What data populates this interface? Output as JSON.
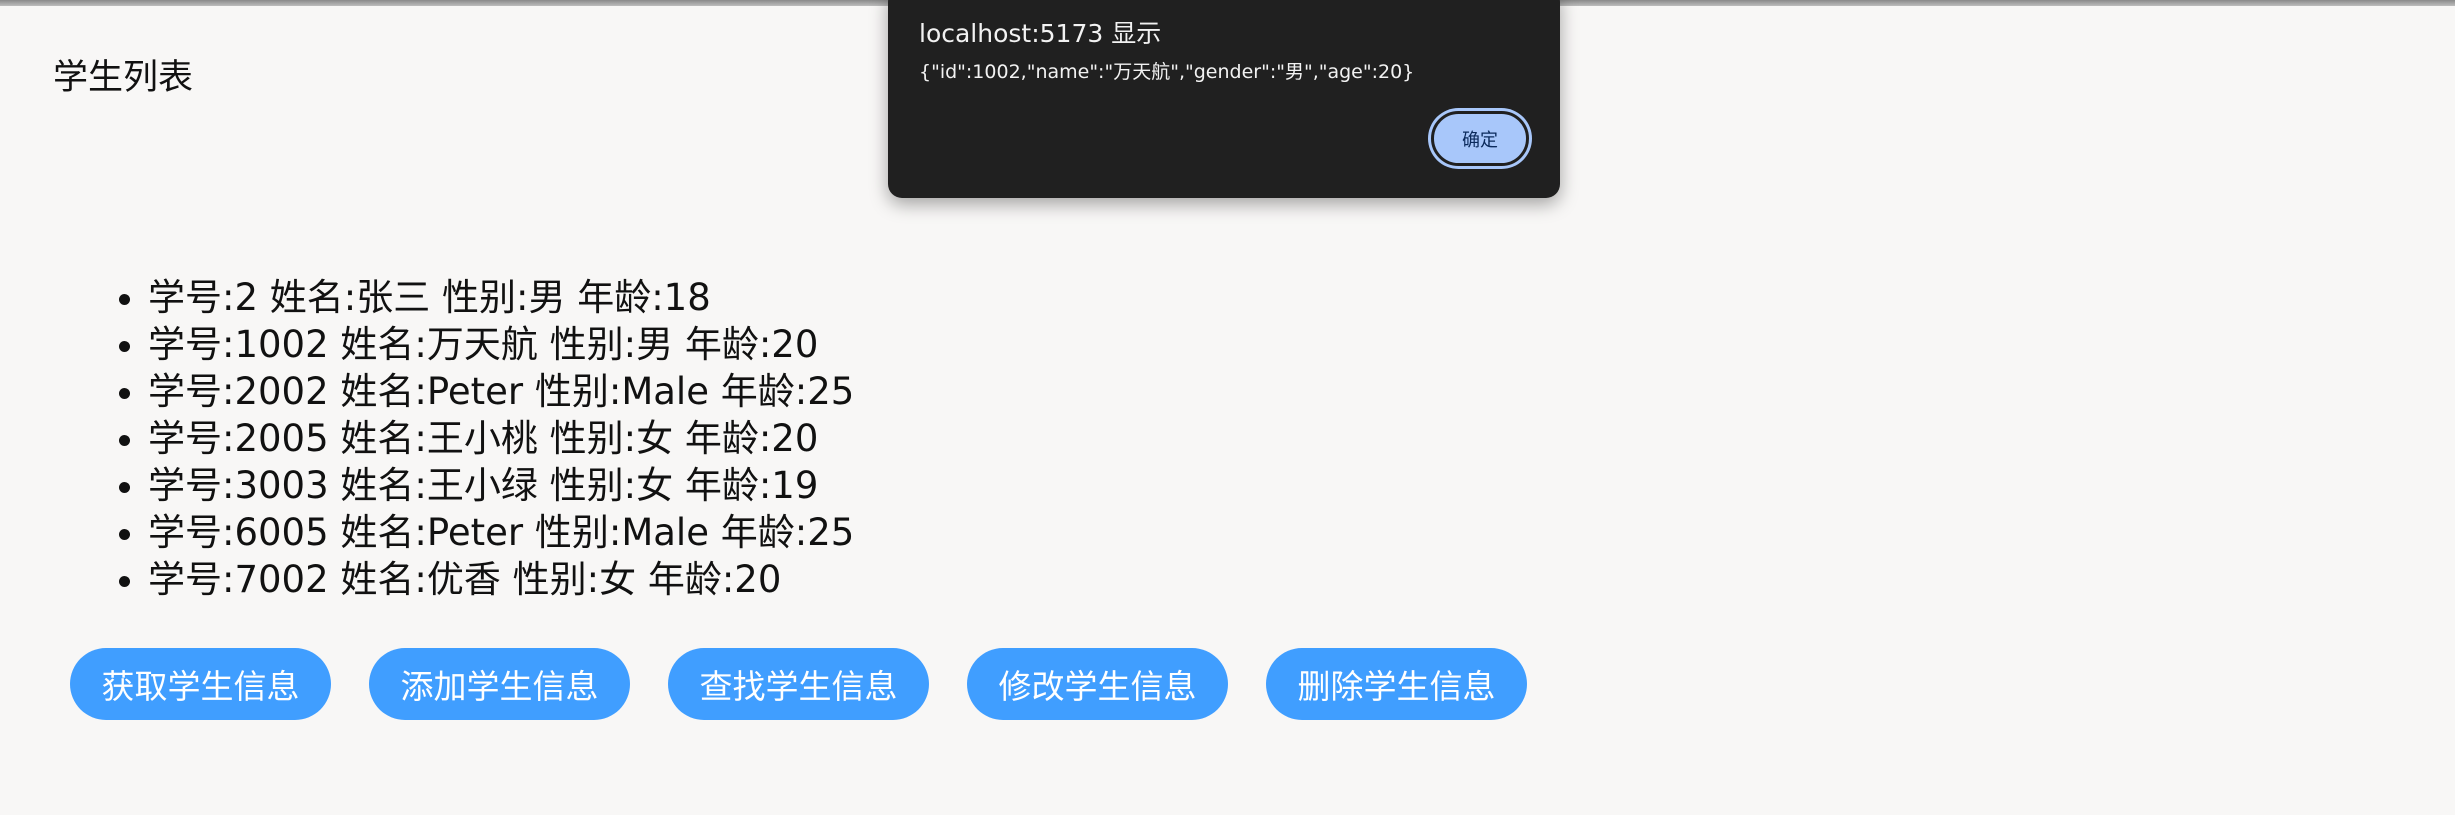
{
  "page": {
    "title": "学生列表"
  },
  "students": [
    {
      "text": "学号:2 姓名:张三 性别:男 年龄:18"
    },
    {
      "text": "学号:1002 姓名:万天航 性别:男 年龄:20"
    },
    {
      "text": "学号:2002 姓名:Peter 性别:Male 年龄:25"
    },
    {
      "text": "学号:2005 姓名:王小桃 性别:女 年龄:20"
    },
    {
      "text": "学号:3003 姓名:王小绿 性别:女 年龄:19"
    },
    {
      "text": "学号:6005 姓名:Peter 性别:Male 年龄:25"
    },
    {
      "text": "学号:7002 姓名:优香 性别:女 年龄:20"
    }
  ],
  "actions": {
    "get_label": "获取学生信息",
    "add_label": "添加学生信息",
    "find_label": "查找学生信息",
    "edit_label": "修改学生信息",
    "delete_label": "删除学生信息"
  },
  "dialog": {
    "title": "localhost:5173 显示",
    "message": "{\"id\":1002,\"name\":\"万天航\",\"gender\":\"男\",\"age\":20}",
    "ok_label": "确定"
  },
  "colors": {
    "primary_button": "#409eff",
    "dialog_background": "#202020",
    "dialog_button": "#a8c7fa"
  }
}
